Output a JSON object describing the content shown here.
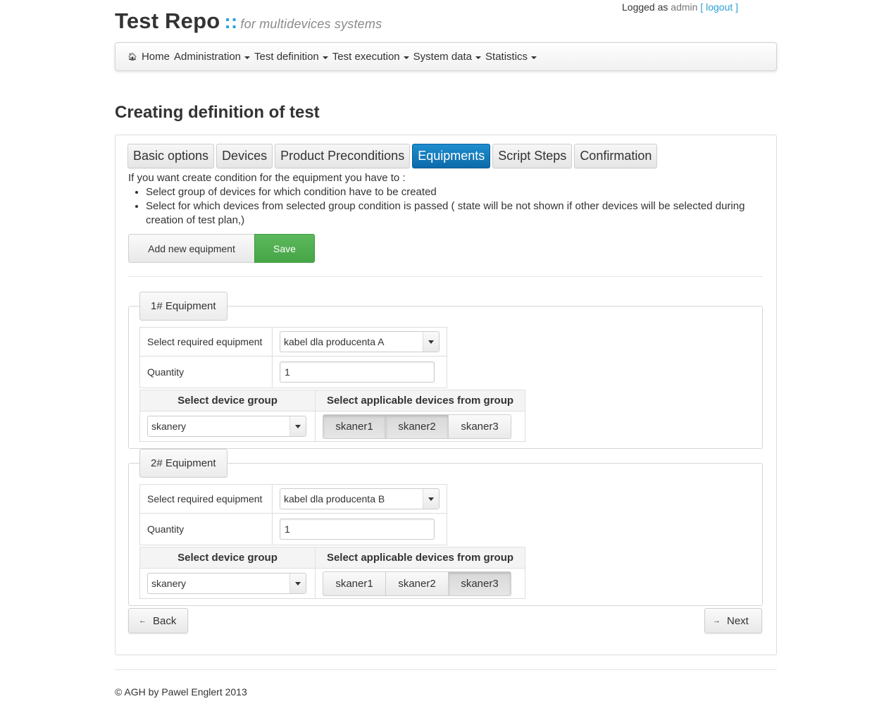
{
  "brand": {
    "title": "Test Repo",
    "separator": "::",
    "tagline": "for multidevices systems"
  },
  "login": {
    "prefix": "Logged as",
    "user": "admin",
    "logout": "[ logout ]"
  },
  "nav": {
    "home": "Home",
    "items": [
      "Administration",
      "Test definition",
      "Test execution",
      "System data",
      "Statistics"
    ]
  },
  "page_title": "Creating definition of test",
  "tabs": [
    "Basic options",
    "Devices",
    "Product Preconditions",
    "Equipments",
    "Script Steps",
    "Confirmation"
  ],
  "active_tab": "Equipments",
  "intro": {
    "lead": "If you want create condition for the equipment you have to :",
    "steps": [
      "Select group of devices for which condition have to be created",
      "Select for which devices from selected group condition is passed ( state will be not shown if other devices will be selected during creation of test plan,)"
    ]
  },
  "actions": {
    "add": "Add new equipment",
    "save": "Save"
  },
  "labels": {
    "select_required": "Select required equipment",
    "quantity": "Quantity",
    "device_group_header": "Select device group",
    "applicable_header": "Select applicable devices from group"
  },
  "equipments": [
    {
      "legend": "1# Equipment",
      "equipment": "kabel dla producenta A",
      "quantity": "1",
      "group": "skanery",
      "devices": [
        "skaner1",
        "skaner2",
        "skaner3"
      ],
      "selected": [
        true,
        true,
        false
      ]
    },
    {
      "legend": "2# Equipment",
      "equipment": "kabel dla producenta B",
      "quantity": "1",
      "group": "skanery",
      "devices": [
        "skaner1",
        "skaner2",
        "skaner3"
      ],
      "selected": [
        false,
        false,
        true
      ]
    }
  ],
  "footer_nav": {
    "back": "Back",
    "next": "Next"
  },
  "footer": "© AGH by Pawel Englert 2013",
  "colors": {
    "accent": "#2a9fd6",
    "active_tab": "#0b6aa9",
    "save": "#5cb85c"
  }
}
